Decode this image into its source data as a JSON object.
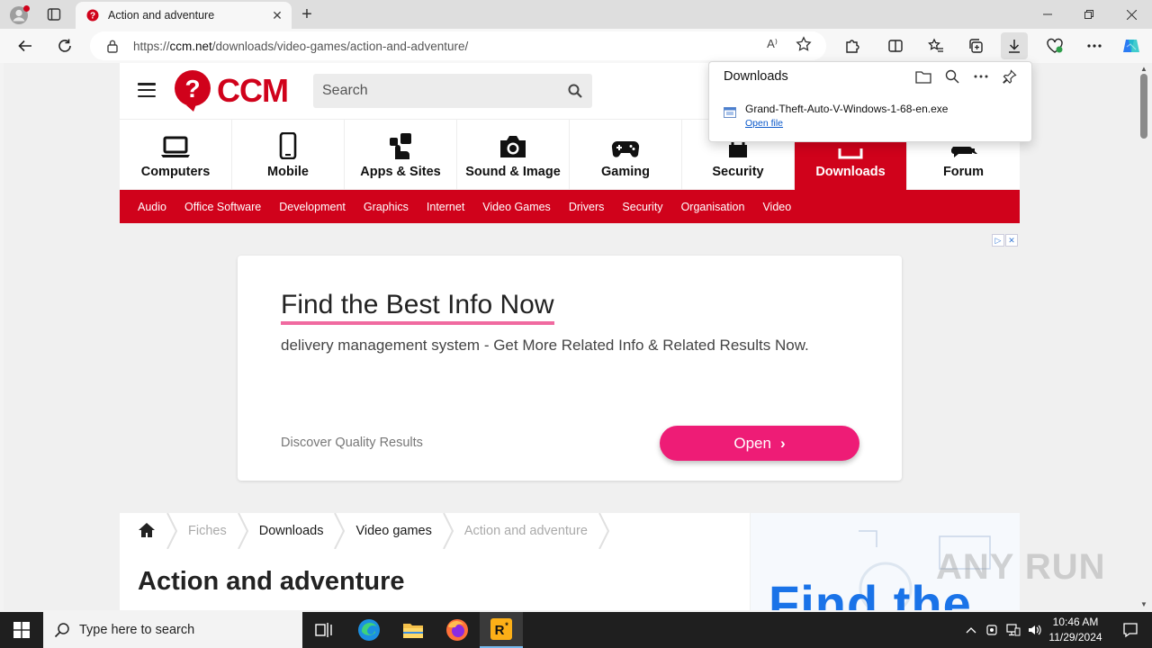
{
  "browser": {
    "tab_title": "Action and adventure",
    "url_prefix": "https://",
    "url_domain": "ccm.net",
    "url_path": "/downloads/video-games/action-and-adventure/",
    "read_aloud": "A⁾"
  },
  "site": {
    "logo_text": "CCM",
    "search_placeholder": "Search",
    "nav": [
      {
        "label": "Computers",
        "icon": "laptop-icon"
      },
      {
        "label": "Mobile",
        "icon": "phone-icon"
      },
      {
        "label": "Apps & Sites",
        "icon": "apps-icon"
      },
      {
        "label": "Sound & Image",
        "icon": "camera-icon"
      },
      {
        "label": "Gaming",
        "icon": "gamepad-icon"
      },
      {
        "label": "Security",
        "icon": "shield-icon"
      },
      {
        "label": "Downloads",
        "icon": "download-icon"
      },
      {
        "label": "Forum",
        "icon": "forum-icon"
      }
    ],
    "subnav": [
      "Audio",
      "Office Software",
      "Development",
      "Graphics",
      "Internet",
      "Video Games",
      "Drivers",
      "Security",
      "Organisation",
      "Video"
    ],
    "brand_color": "#d0021b"
  },
  "ad": {
    "title": "Find the Best Info Now",
    "description": "delivery management system - Get More Related Info & Related Results Now.",
    "footer": "Discover Quality Results",
    "button": "Open",
    "side_text": "Find the"
  },
  "breadcrumb": [
    "Fiches",
    "Downloads",
    "Video games",
    "Action and adventure"
  ],
  "page_title": "Action and adventure",
  "downloads_panel": {
    "title": "Downloads",
    "file_name": "Grand-Theft-Auto-V-Windows-1-68-en.exe",
    "open_link": "Open file"
  },
  "taskbar": {
    "search_placeholder": "Type here to search",
    "time": "10:46 AM",
    "date": "11/29/2024"
  },
  "watermark": "ANY RUN"
}
